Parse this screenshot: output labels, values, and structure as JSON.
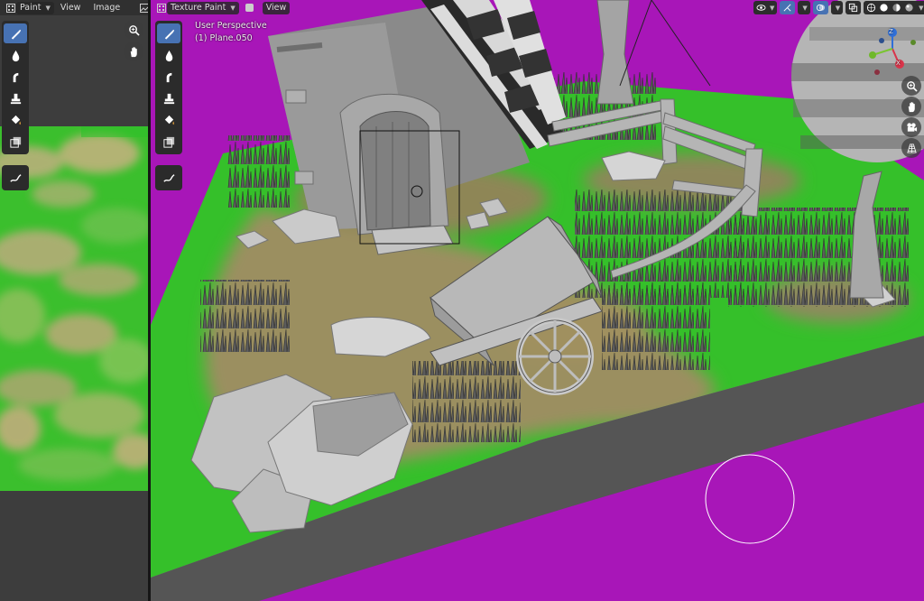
{
  "image_editor": {
    "mode_label": "Paint",
    "menus": [
      "View",
      "Image"
    ],
    "tools": [
      "draw-brush-icon",
      "soften-icon",
      "smear-icon",
      "clone-icon",
      "fill-icon",
      "mask-icon",
      "annotate-icon"
    ],
    "nav": [
      "zoom-icon",
      "pan-hand-icon"
    ]
  },
  "viewport": {
    "mode_label": "Texture Paint",
    "menus": [
      "View"
    ],
    "perspective_label": "User Perspective",
    "object_label": "(1) Plane.050",
    "gizmo_axes": [
      "X",
      "Y",
      "Z"
    ],
    "header_icons": [
      "visibility-icon",
      "gizmo-icon",
      "overlay-icon",
      "xray-icon",
      "wireframe-shading-icon",
      "solid-shading-icon",
      "material-shading-icon",
      "rendered-shading-icon"
    ],
    "nav": [
      "zoom-icon",
      "pan-hand-icon",
      "camera-icon",
      "grid-icon"
    ]
  },
  "colors": {
    "accent": "#4772b3",
    "background_magenta": "#a816b8",
    "grass_green": "#30c02a",
    "path_tan": "#a89a6a",
    "road_grey": "#555555"
  }
}
